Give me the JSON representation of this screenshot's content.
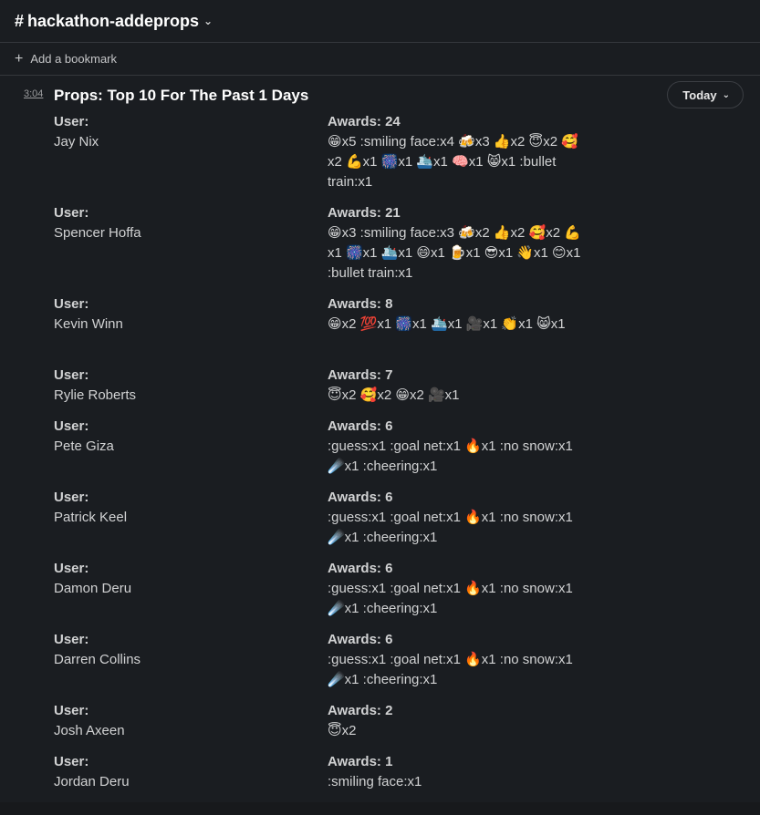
{
  "channel": {
    "hash": "#",
    "name": "hackathon-addeprops"
  },
  "bookmark": {
    "label": "Add a bookmark"
  },
  "message": {
    "time": "3:04",
    "title": "Props: Top 10 For The Past 1 Days",
    "filter_label": "Today"
  },
  "entries": [
    {
      "user_label": "User:",
      "user": "Jay Nix",
      "awards_label": "Awards: 24",
      "awards_text": "😁x5 :smiling face:x4 🍻x3 👍x2 😇x2 🥰x2 💪x1 🎆x1 🛳️x1 🧠x1 😸x1 :bullet train:x1"
    },
    {
      "user_label": "User:",
      "user": "Spencer Hoffa",
      "awards_label": "Awards: 21",
      "awards_text": "😁x3 :smiling face:x3 🍻x2 👍x2 🥰x2 💪x1 🎆x1 🛳️x1 😄x1 🍺x1 😎x1 👋x1 😊x1 :bullet train:x1"
    },
    {
      "user_label": "User:",
      "user": "Kevin Winn",
      "awards_label": "Awards: 8",
      "awards_text": "😁x2 💯x1 🎆x1 🛳️x1 🎥x1 👏x1 😸x1"
    },
    {
      "user_label": "User:",
      "user": "Rylie Roberts",
      "awards_label": "Awards: 7",
      "awards_text": "😇x2 🥰x2 😁x2 🎥x1"
    },
    {
      "user_label": "User:",
      "user": "Pete Giza",
      "awards_label": "Awards: 6",
      "awards_text": ":guess:x1 :goal net:x1 🔥x1 :no snow:x1 ☄️x1 :cheering:x1"
    },
    {
      "user_label": "User:",
      "user": "Patrick Keel",
      "awards_label": "Awards: 6",
      "awards_text": ":guess:x1 :goal net:x1 🔥x1 :no snow:x1 ☄️x1 :cheering:x1"
    },
    {
      "user_label": "User:",
      "user": "Damon Deru",
      "awards_label": "Awards: 6",
      "awards_text": ":guess:x1 :goal net:x1 🔥x1 :no snow:x1 ☄️x1 :cheering:x1"
    },
    {
      "user_label": "User:",
      "user": "Darren Collins",
      "awards_label": "Awards: 6",
      "awards_text": ":guess:x1 :goal net:x1 🔥x1 :no snow:x1 ☄️x1 :cheering:x1"
    },
    {
      "user_label": "User:",
      "user": "Josh Axeen",
      "awards_label": "Awards: 2",
      "awards_text": "😇x2"
    },
    {
      "user_label": "User:",
      "user": "Jordan Deru",
      "awards_label": "Awards: 1",
      "awards_text": ":smiling face:x1"
    }
  ]
}
